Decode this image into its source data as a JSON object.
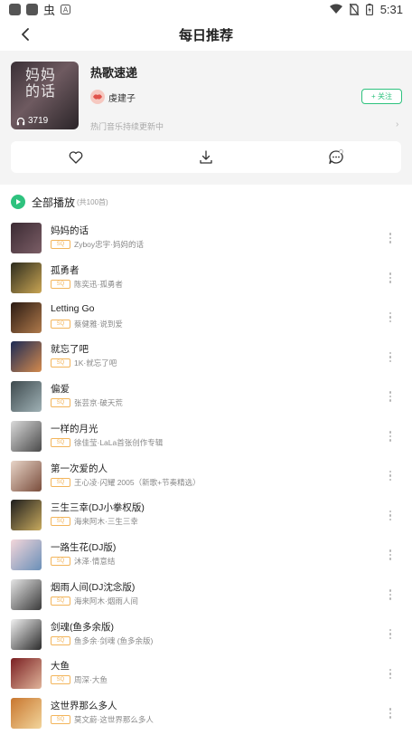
{
  "status_bar": {
    "time": "5:31",
    "app_glyph": "虫"
  },
  "header": {
    "title": "每日推荐"
  },
  "playlist": {
    "cover_text": "妈妈的话",
    "play_count": "3719",
    "title": "热歌速递",
    "author": "虔建子",
    "follow_label": "+ 关注",
    "description": "热门音乐持续更新中"
  },
  "play_all": {
    "label": "全部播放",
    "count": "(共100首)"
  },
  "badge_label": "SQ",
  "songs": [
    {
      "title": "妈妈的话",
      "sub": "Zyboy忠宇·妈妈的话",
      "c1": "#3b2a33",
      "c2": "#7b5e66"
    },
    {
      "title": "孤勇者",
      "sub": "陈奕迅·孤勇者",
      "c1": "#2d2c1e",
      "c2": "#c9a553"
    },
    {
      "title": "Letting Go",
      "sub": "蔡健雅·说到爱",
      "c1": "#2a1a12",
      "c2": "#b07a4b"
    },
    {
      "title": "就忘了吧",
      "sub": "1K·就忘了吧",
      "c1": "#1b2a55",
      "c2": "#d48a4d"
    },
    {
      "title": "偏爱",
      "sub": "张芸京·破天荒",
      "c1": "#3e4a4e",
      "c2": "#9fb1b5"
    },
    {
      "title": "一样的月光",
      "sub": "徐佳莹·LaLa首张创作专辑",
      "c1": "#dadada",
      "c2": "#4a4a4a"
    },
    {
      "title": "第一次爱的人",
      "sub": "王心凌·闪耀 2005（新歌+节奏精选）",
      "c1": "#e8d5c8",
      "c2": "#7a4d3c"
    },
    {
      "title": "三生三幸(DJ小拳权版)",
      "sub": "海来阿木·三生三幸",
      "c1": "#1d1d1d",
      "c2": "#c8aa5e"
    },
    {
      "title": "一路生花(DJ版)",
      "sub": "沐泽·情意结",
      "c1": "#f3d6da",
      "c2": "#6a8fb8"
    },
    {
      "title": "烟雨人间(DJ沈念版)",
      "sub": "海来阿木·烟雨人间",
      "c1": "#e5e5e5",
      "c2": "#3a3a3a"
    },
    {
      "title": "剑魂(鱼多余版)",
      "sub": "鱼多余·剑魂 (鱼多余版)",
      "c1": "#f1f1f1",
      "c2": "#2b2b2b"
    },
    {
      "title": "大鱼",
      "sub": "周深·大鱼",
      "c1": "#7a1f22",
      "c2": "#e0b49a"
    },
    {
      "title": "这世界那么多人",
      "sub": "莫文蔚·这世界那么多人",
      "c1": "#c8762f",
      "c2": "#f2d59b"
    }
  ]
}
